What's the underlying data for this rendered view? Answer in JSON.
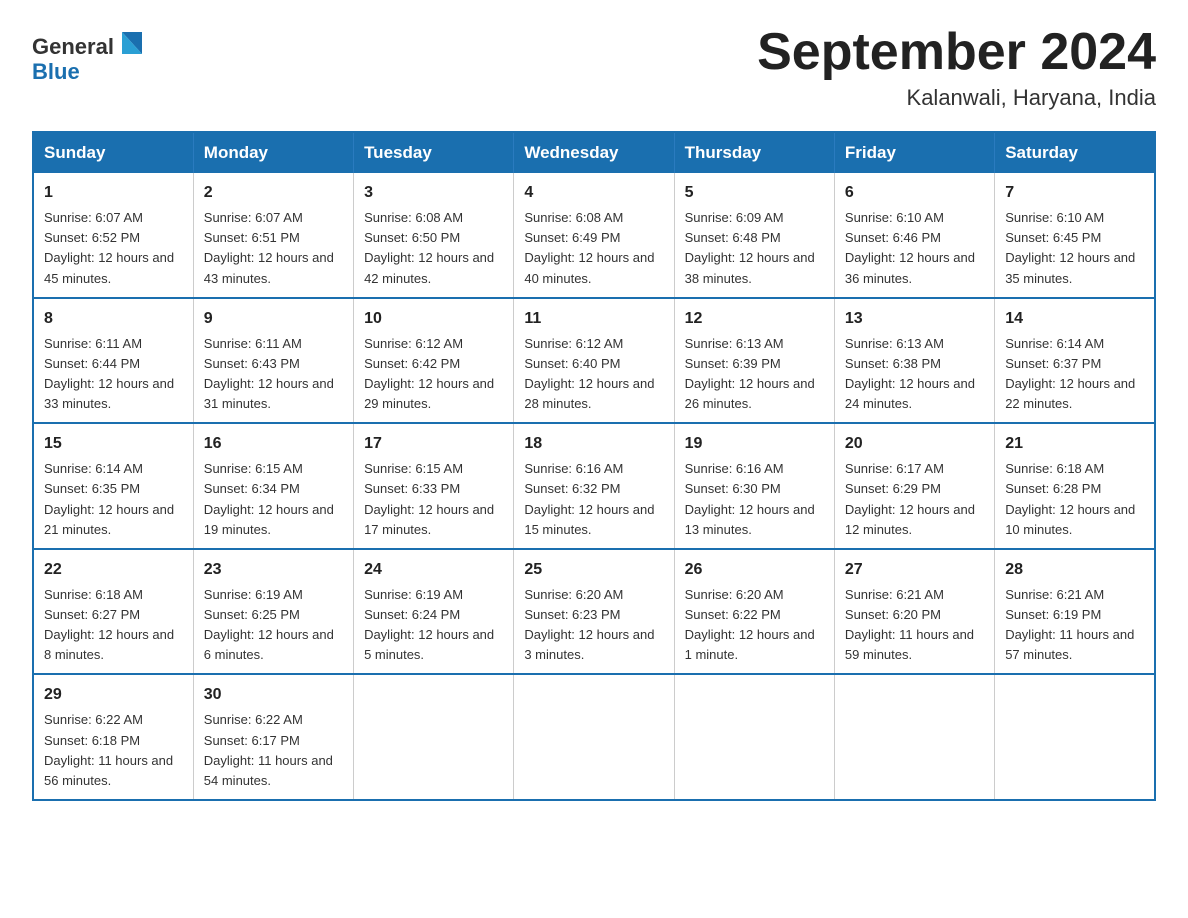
{
  "logo": {
    "text_general": "General",
    "text_blue": "Blue"
  },
  "header": {
    "month_year": "September 2024",
    "location": "Kalanwali, Haryana, India"
  },
  "weekdays": [
    "Sunday",
    "Monday",
    "Tuesday",
    "Wednesday",
    "Thursday",
    "Friday",
    "Saturday"
  ],
  "weeks": [
    [
      {
        "day": "1",
        "sunrise": "6:07 AM",
        "sunset": "6:52 PM",
        "daylight": "12 hours and 45 minutes."
      },
      {
        "day": "2",
        "sunrise": "6:07 AM",
        "sunset": "6:51 PM",
        "daylight": "12 hours and 43 minutes."
      },
      {
        "day": "3",
        "sunrise": "6:08 AM",
        "sunset": "6:50 PM",
        "daylight": "12 hours and 42 minutes."
      },
      {
        "day": "4",
        "sunrise": "6:08 AM",
        "sunset": "6:49 PM",
        "daylight": "12 hours and 40 minutes."
      },
      {
        "day": "5",
        "sunrise": "6:09 AM",
        "sunset": "6:48 PM",
        "daylight": "12 hours and 38 minutes."
      },
      {
        "day": "6",
        "sunrise": "6:10 AM",
        "sunset": "6:46 PM",
        "daylight": "12 hours and 36 minutes."
      },
      {
        "day": "7",
        "sunrise": "6:10 AM",
        "sunset": "6:45 PM",
        "daylight": "12 hours and 35 minutes."
      }
    ],
    [
      {
        "day": "8",
        "sunrise": "6:11 AM",
        "sunset": "6:44 PM",
        "daylight": "12 hours and 33 minutes."
      },
      {
        "day": "9",
        "sunrise": "6:11 AM",
        "sunset": "6:43 PM",
        "daylight": "12 hours and 31 minutes."
      },
      {
        "day": "10",
        "sunrise": "6:12 AM",
        "sunset": "6:42 PM",
        "daylight": "12 hours and 29 minutes."
      },
      {
        "day": "11",
        "sunrise": "6:12 AM",
        "sunset": "6:40 PM",
        "daylight": "12 hours and 28 minutes."
      },
      {
        "day": "12",
        "sunrise": "6:13 AM",
        "sunset": "6:39 PM",
        "daylight": "12 hours and 26 minutes."
      },
      {
        "day": "13",
        "sunrise": "6:13 AM",
        "sunset": "6:38 PM",
        "daylight": "12 hours and 24 minutes."
      },
      {
        "day": "14",
        "sunrise": "6:14 AM",
        "sunset": "6:37 PM",
        "daylight": "12 hours and 22 minutes."
      }
    ],
    [
      {
        "day": "15",
        "sunrise": "6:14 AM",
        "sunset": "6:35 PM",
        "daylight": "12 hours and 21 minutes."
      },
      {
        "day": "16",
        "sunrise": "6:15 AM",
        "sunset": "6:34 PM",
        "daylight": "12 hours and 19 minutes."
      },
      {
        "day": "17",
        "sunrise": "6:15 AM",
        "sunset": "6:33 PM",
        "daylight": "12 hours and 17 minutes."
      },
      {
        "day": "18",
        "sunrise": "6:16 AM",
        "sunset": "6:32 PM",
        "daylight": "12 hours and 15 minutes."
      },
      {
        "day": "19",
        "sunrise": "6:16 AM",
        "sunset": "6:30 PM",
        "daylight": "12 hours and 13 minutes."
      },
      {
        "day": "20",
        "sunrise": "6:17 AM",
        "sunset": "6:29 PM",
        "daylight": "12 hours and 12 minutes."
      },
      {
        "day": "21",
        "sunrise": "6:18 AM",
        "sunset": "6:28 PM",
        "daylight": "12 hours and 10 minutes."
      }
    ],
    [
      {
        "day": "22",
        "sunrise": "6:18 AM",
        "sunset": "6:27 PM",
        "daylight": "12 hours and 8 minutes."
      },
      {
        "day": "23",
        "sunrise": "6:19 AM",
        "sunset": "6:25 PM",
        "daylight": "12 hours and 6 minutes."
      },
      {
        "day": "24",
        "sunrise": "6:19 AM",
        "sunset": "6:24 PM",
        "daylight": "12 hours and 5 minutes."
      },
      {
        "day": "25",
        "sunrise": "6:20 AM",
        "sunset": "6:23 PM",
        "daylight": "12 hours and 3 minutes."
      },
      {
        "day": "26",
        "sunrise": "6:20 AM",
        "sunset": "6:22 PM",
        "daylight": "12 hours and 1 minute."
      },
      {
        "day": "27",
        "sunrise": "6:21 AM",
        "sunset": "6:20 PM",
        "daylight": "11 hours and 59 minutes."
      },
      {
        "day": "28",
        "sunrise": "6:21 AM",
        "sunset": "6:19 PM",
        "daylight": "11 hours and 57 minutes."
      }
    ],
    [
      {
        "day": "29",
        "sunrise": "6:22 AM",
        "sunset": "6:18 PM",
        "daylight": "11 hours and 56 minutes."
      },
      {
        "day": "30",
        "sunrise": "6:22 AM",
        "sunset": "6:17 PM",
        "daylight": "11 hours and 54 minutes."
      },
      null,
      null,
      null,
      null,
      null
    ]
  ],
  "labels": {
    "sunrise_prefix": "Sunrise: ",
    "sunset_prefix": "Sunset: ",
    "daylight_prefix": "Daylight: "
  }
}
